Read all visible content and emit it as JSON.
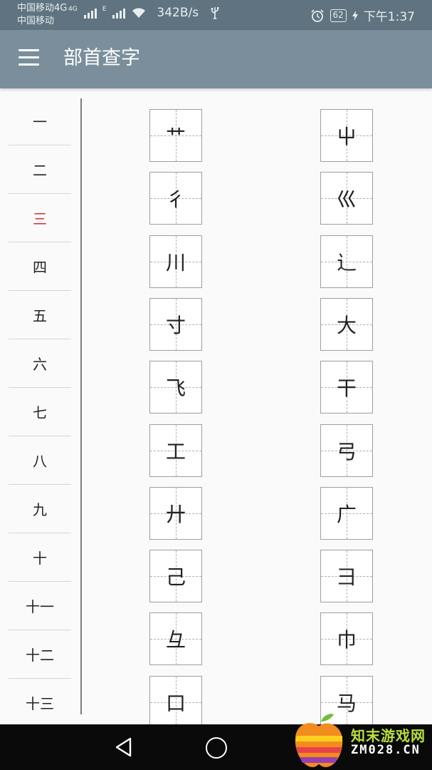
{
  "status_bar": {
    "carrier_line1": "中国移动4G",
    "carrier_line2": "中国移动",
    "network_tag_1": "4G",
    "network_tag_2": "E",
    "net_speed": "342B/s",
    "usb_icon": "usb-icon",
    "alarm_icon": "alarm-icon",
    "battery_level": "62",
    "time": "下午1:37"
  },
  "app_bar": {
    "menu_icon": "hamburger-menu-icon",
    "title": "部首查字"
  },
  "stroke_counts": {
    "selected": "三",
    "items": [
      "一",
      "二",
      "三",
      "四",
      "五",
      "六",
      "七",
      "八",
      "九",
      "十",
      "十一",
      "十二",
      "十三"
    ]
  },
  "radicals": {
    "left_column": [
      "艹",
      "彳",
      "川",
      "寸",
      "飞",
      "工",
      "廾",
      "己",
      "彑",
      "口"
    ],
    "right_column": [
      "屮",
      "巛",
      "辶",
      "大",
      "干",
      "弓",
      "广",
      "彐",
      "巾",
      "马"
    ]
  },
  "nav_bar": {
    "back_icon": "back-triangle-icon",
    "home_icon": "home-circle-icon"
  },
  "watermark": {
    "line1": "知末游戏网",
    "line2": "ZM028.CN"
  },
  "colors": {
    "status_bar": "#5f7480",
    "app_bar": "#7a8f9b",
    "active_item": "#d32f2f",
    "nav_bar": "#0a0a0a"
  }
}
